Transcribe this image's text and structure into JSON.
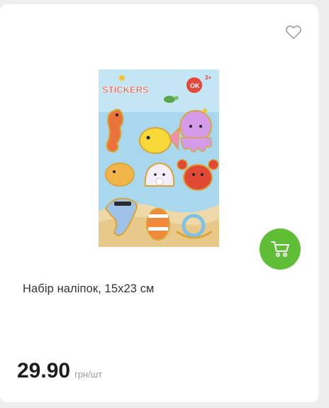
{
  "product": {
    "title": "Набір наліпок, 15х23 см",
    "price": "29.90",
    "unit": "грн/шт",
    "image": {
      "header": "STICKERS",
      "age": "3+",
      "brand_mark": "OK",
      "background_color": "#a9d8ee",
      "sand_color": "#f0d9a8"
    }
  },
  "colors": {
    "accent": "#5fbd36",
    "card_bg": "#ffffff",
    "page_bg": "#eeeeee"
  },
  "icons": {
    "favorite": "heart-icon",
    "cart": "shopping-cart-icon"
  }
}
